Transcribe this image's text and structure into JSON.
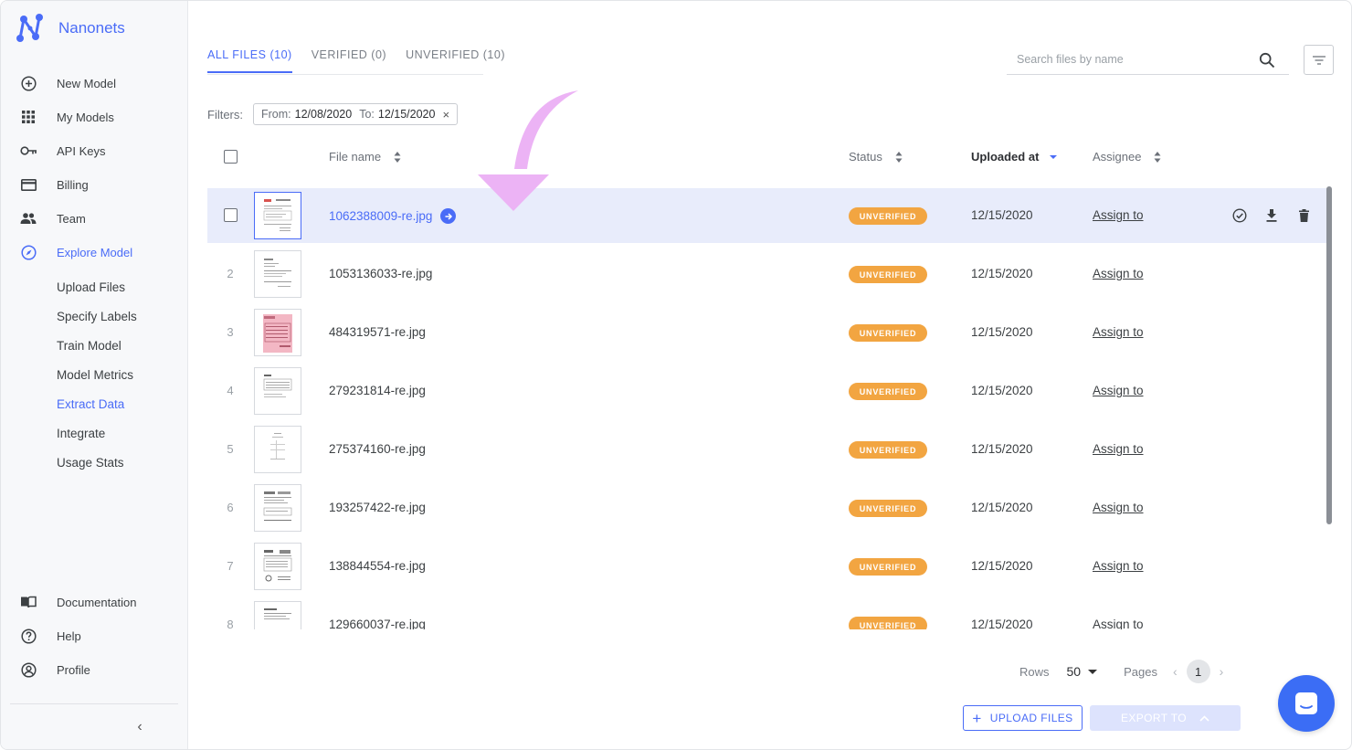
{
  "brand": {
    "name": "Nanonets"
  },
  "sidebar": {
    "items": [
      {
        "label": "New Model",
        "icon": "plus-circle-icon"
      },
      {
        "label": "My Models",
        "icon": "grid-icon"
      },
      {
        "label": "API Keys",
        "icon": "key-icon"
      },
      {
        "label": "Billing",
        "icon": "credit-card-icon"
      },
      {
        "label": "Team",
        "icon": "people-icon"
      },
      {
        "label": "Explore Model",
        "icon": "compass-icon",
        "active": true
      }
    ],
    "sub_items": [
      {
        "label": "Upload Files"
      },
      {
        "label": "Specify Labels"
      },
      {
        "label": "Train Model"
      },
      {
        "label": "Model Metrics"
      },
      {
        "label": "Extract Data",
        "active": true
      },
      {
        "label": "Integrate"
      },
      {
        "label": "Usage Stats"
      }
    ],
    "bottom_items": [
      {
        "label": "Documentation",
        "icon": "book-icon"
      },
      {
        "label": "Help",
        "icon": "help-circle-icon"
      },
      {
        "label": "Profile",
        "icon": "user-circle-icon"
      }
    ],
    "collapse_glyph": "‹"
  },
  "tabs": [
    {
      "label": "ALL FILES (10)",
      "active": true
    },
    {
      "label": "VERIFIED (0)"
    },
    {
      "label": "UNVERIFIED (10)"
    }
  ],
  "search": {
    "placeholder": "Search files by name",
    "value": ""
  },
  "filters": {
    "label": "Filters:",
    "from_label": "From:",
    "from_value": "12/08/2020",
    "to_label": "To:",
    "to_value": "12/15/2020",
    "close_glyph": "×"
  },
  "table": {
    "columns": {
      "file_name": "File name",
      "status": "Status",
      "uploaded_at": "Uploaded at",
      "assignee": "Assignee"
    },
    "rows": [
      {
        "index": "",
        "file_name": "1062388009-re.jpg",
        "status": "UNVERIFIED",
        "uploaded_at": "12/15/2020",
        "assignee": "Assign to",
        "selected": true
      },
      {
        "index": "2",
        "file_name": "1053136033-re.jpg",
        "status": "UNVERIFIED",
        "uploaded_at": "12/15/2020",
        "assignee": "Assign to"
      },
      {
        "index": "3",
        "file_name": "484319571-re.jpg",
        "status": "UNVERIFIED",
        "uploaded_at": "12/15/2020",
        "assignee": "Assign to"
      },
      {
        "index": "4",
        "file_name": "279231814-re.jpg",
        "status": "UNVERIFIED",
        "uploaded_at": "12/15/2020",
        "assignee": "Assign to"
      },
      {
        "index": "5",
        "file_name": "275374160-re.jpg",
        "status": "UNVERIFIED",
        "uploaded_at": "12/15/2020",
        "assignee": "Assign to"
      },
      {
        "index": "6",
        "file_name": "193257422-re.jpg",
        "status": "UNVERIFIED",
        "uploaded_at": "12/15/2020",
        "assignee": "Assign to"
      },
      {
        "index": "7",
        "file_name": "138844554-re.jpg",
        "status": "UNVERIFIED",
        "uploaded_at": "12/15/2020",
        "assignee": "Assign to"
      },
      {
        "index": "8",
        "file_name": "129660037-re.jpg",
        "status": "UNVERIFIED",
        "uploaded_at": "12/15/2020",
        "assignee": "Assign to"
      }
    ]
  },
  "pagination": {
    "rows_label": "Rows",
    "rows_value": "50",
    "pages_label": "Pages",
    "current_page": "1",
    "prev_glyph": "‹",
    "next_glyph": "›"
  },
  "buttons": {
    "upload": "UPLOAD FILES",
    "upload_glyph": "+",
    "export": "EXPORT TO",
    "export_glyph": "⌃"
  },
  "colors": {
    "accent": "#4a6cf7",
    "status_unverified": "#f2a541",
    "selected_row": "#e8ecfb",
    "annotation_arrow": "#ecb3f5",
    "chat": "#3b6df5"
  }
}
